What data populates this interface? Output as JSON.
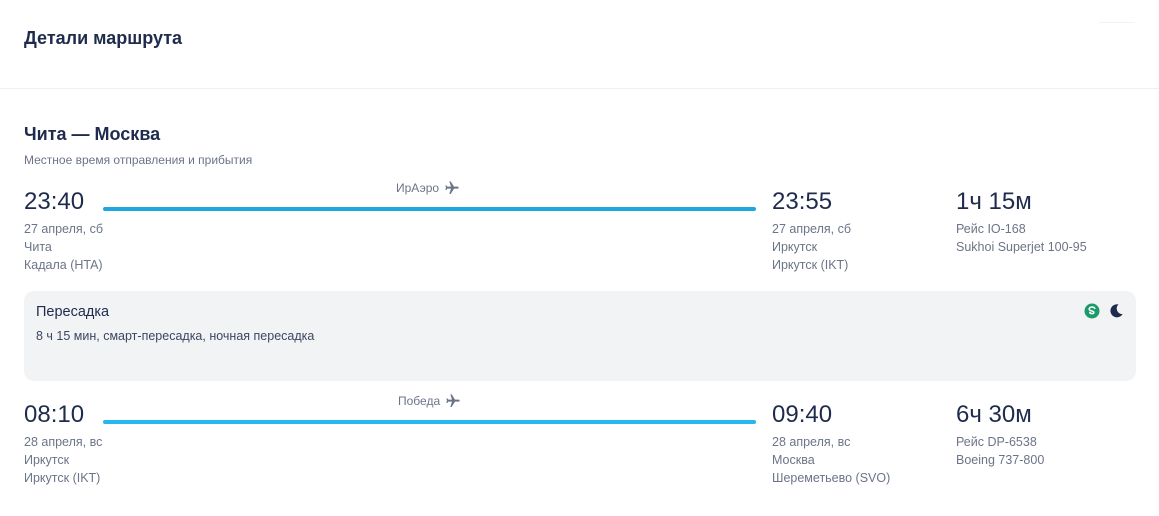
{
  "header": {
    "title": "Детали маршрута"
  },
  "route": {
    "title": "Чита — Москва",
    "subtitle": "Местное время отправления и прибытия"
  },
  "segments": [
    {
      "departure": {
        "time": "23:40",
        "date": "27 апреля, сб",
        "city": "Чита",
        "airport": "Кадала (HTA)"
      },
      "carrier": "ИрАэро",
      "arrival": {
        "time": "23:55",
        "date": "27 апреля, сб",
        "city": "Иркутск",
        "airport": "Иркутск (IKT)"
      },
      "duration": "1ч 15м",
      "flight": "Рейс IO-168",
      "aircraft": "Sukhoi Superjet 100-95",
      "bar_color": "#1da7de"
    },
    {
      "departure": {
        "time": "08:10",
        "date": "28 апреля, вс",
        "city": "Иркутск",
        "airport": "Иркутск (IKT)"
      },
      "carrier": "Победа",
      "arrival": {
        "time": "09:40",
        "date": "28 апреля, вс",
        "city": "Москва",
        "airport": "Шереметьево (SVO)"
      },
      "duration": "6ч 30м",
      "flight": "Рейс DP-6538",
      "aircraft": "Boeing 737-800",
      "bar_color": "#27b6ef"
    }
  ],
  "transfer": {
    "title": "Пересадка",
    "details": "8 ч 15 мин, смарт-пересадка, ночная пересадка",
    "icons": [
      "smart-transfer-icon",
      "night-moon-icon"
    ],
    "icon_colors": {
      "smart": "#1d9a6c",
      "moon": "#1f2b4d"
    }
  },
  "colors": {
    "text": "#1f2b4d",
    "muted": "#6b7488",
    "accent": "#1da7de"
  }
}
